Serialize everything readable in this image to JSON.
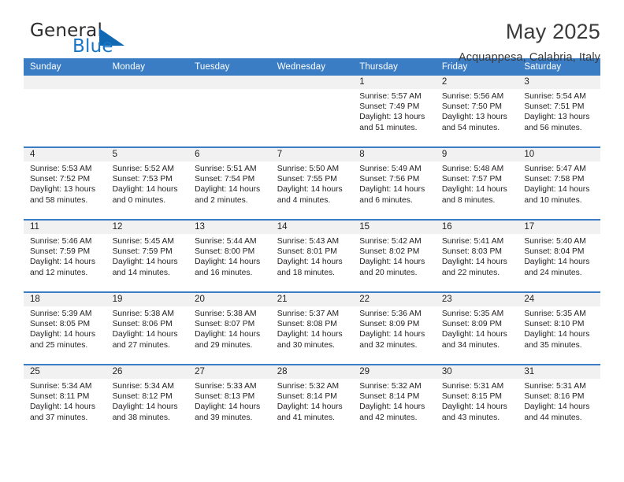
{
  "brand": {
    "name_part1": "General",
    "name_part2": "Blue",
    "accent_color": "#1168b3"
  },
  "header": {
    "month_title": "May 2025",
    "location": "Acquappesa, Calabria, Italy"
  },
  "calendar": {
    "header_background": "#3b7dc4",
    "daynum_band_background": "#f1f1f1",
    "weekday_headers": [
      "Sunday",
      "Monday",
      "Tuesday",
      "Wednesday",
      "Thursday",
      "Friday",
      "Saturday"
    ],
    "weeks": [
      [
        {
          "day": "",
          "sunrise": "",
          "sunset": "",
          "daylight_line1": "",
          "daylight_line2": ""
        },
        {
          "day": "",
          "sunrise": "",
          "sunset": "",
          "daylight_line1": "",
          "daylight_line2": ""
        },
        {
          "day": "",
          "sunrise": "",
          "sunset": "",
          "daylight_line1": "",
          "daylight_line2": ""
        },
        {
          "day": "",
          "sunrise": "",
          "sunset": "",
          "daylight_line1": "",
          "daylight_line2": ""
        },
        {
          "day": "1",
          "sunrise": "Sunrise: 5:57 AM",
          "sunset": "Sunset: 7:49 PM",
          "daylight_line1": "Daylight: 13 hours",
          "daylight_line2": "and 51 minutes."
        },
        {
          "day": "2",
          "sunrise": "Sunrise: 5:56 AM",
          "sunset": "Sunset: 7:50 PM",
          "daylight_line1": "Daylight: 13 hours",
          "daylight_line2": "and 54 minutes."
        },
        {
          "day": "3",
          "sunrise": "Sunrise: 5:54 AM",
          "sunset": "Sunset: 7:51 PM",
          "daylight_line1": "Daylight: 13 hours",
          "daylight_line2": "and 56 minutes."
        }
      ],
      [
        {
          "day": "4",
          "sunrise": "Sunrise: 5:53 AM",
          "sunset": "Sunset: 7:52 PM",
          "daylight_line1": "Daylight: 13 hours",
          "daylight_line2": "and 58 minutes."
        },
        {
          "day": "5",
          "sunrise": "Sunrise: 5:52 AM",
          "sunset": "Sunset: 7:53 PM",
          "daylight_line1": "Daylight: 14 hours",
          "daylight_line2": "and 0 minutes."
        },
        {
          "day": "6",
          "sunrise": "Sunrise: 5:51 AM",
          "sunset": "Sunset: 7:54 PM",
          "daylight_line1": "Daylight: 14 hours",
          "daylight_line2": "and 2 minutes."
        },
        {
          "day": "7",
          "sunrise": "Sunrise: 5:50 AM",
          "sunset": "Sunset: 7:55 PM",
          "daylight_line1": "Daylight: 14 hours",
          "daylight_line2": "and 4 minutes."
        },
        {
          "day": "8",
          "sunrise": "Sunrise: 5:49 AM",
          "sunset": "Sunset: 7:56 PM",
          "daylight_line1": "Daylight: 14 hours",
          "daylight_line2": "and 6 minutes."
        },
        {
          "day": "9",
          "sunrise": "Sunrise: 5:48 AM",
          "sunset": "Sunset: 7:57 PM",
          "daylight_line1": "Daylight: 14 hours",
          "daylight_line2": "and 8 minutes."
        },
        {
          "day": "10",
          "sunrise": "Sunrise: 5:47 AM",
          "sunset": "Sunset: 7:58 PM",
          "daylight_line1": "Daylight: 14 hours",
          "daylight_line2": "and 10 minutes."
        }
      ],
      [
        {
          "day": "11",
          "sunrise": "Sunrise: 5:46 AM",
          "sunset": "Sunset: 7:59 PM",
          "daylight_line1": "Daylight: 14 hours",
          "daylight_line2": "and 12 minutes."
        },
        {
          "day": "12",
          "sunrise": "Sunrise: 5:45 AM",
          "sunset": "Sunset: 7:59 PM",
          "daylight_line1": "Daylight: 14 hours",
          "daylight_line2": "and 14 minutes."
        },
        {
          "day": "13",
          "sunrise": "Sunrise: 5:44 AM",
          "sunset": "Sunset: 8:00 PM",
          "daylight_line1": "Daylight: 14 hours",
          "daylight_line2": "and 16 minutes."
        },
        {
          "day": "14",
          "sunrise": "Sunrise: 5:43 AM",
          "sunset": "Sunset: 8:01 PM",
          "daylight_line1": "Daylight: 14 hours",
          "daylight_line2": "and 18 minutes."
        },
        {
          "day": "15",
          "sunrise": "Sunrise: 5:42 AM",
          "sunset": "Sunset: 8:02 PM",
          "daylight_line1": "Daylight: 14 hours",
          "daylight_line2": "and 20 minutes."
        },
        {
          "day": "16",
          "sunrise": "Sunrise: 5:41 AM",
          "sunset": "Sunset: 8:03 PM",
          "daylight_line1": "Daylight: 14 hours",
          "daylight_line2": "and 22 minutes."
        },
        {
          "day": "17",
          "sunrise": "Sunrise: 5:40 AM",
          "sunset": "Sunset: 8:04 PM",
          "daylight_line1": "Daylight: 14 hours",
          "daylight_line2": "and 24 minutes."
        }
      ],
      [
        {
          "day": "18",
          "sunrise": "Sunrise: 5:39 AM",
          "sunset": "Sunset: 8:05 PM",
          "daylight_line1": "Daylight: 14 hours",
          "daylight_line2": "and 25 minutes."
        },
        {
          "day": "19",
          "sunrise": "Sunrise: 5:38 AM",
          "sunset": "Sunset: 8:06 PM",
          "daylight_line1": "Daylight: 14 hours",
          "daylight_line2": "and 27 minutes."
        },
        {
          "day": "20",
          "sunrise": "Sunrise: 5:38 AM",
          "sunset": "Sunset: 8:07 PM",
          "daylight_line1": "Daylight: 14 hours",
          "daylight_line2": "and 29 minutes."
        },
        {
          "day": "21",
          "sunrise": "Sunrise: 5:37 AM",
          "sunset": "Sunset: 8:08 PM",
          "daylight_line1": "Daylight: 14 hours",
          "daylight_line2": "and 30 minutes."
        },
        {
          "day": "22",
          "sunrise": "Sunrise: 5:36 AM",
          "sunset": "Sunset: 8:09 PM",
          "daylight_line1": "Daylight: 14 hours",
          "daylight_line2": "and 32 minutes."
        },
        {
          "day": "23",
          "sunrise": "Sunrise: 5:35 AM",
          "sunset": "Sunset: 8:09 PM",
          "daylight_line1": "Daylight: 14 hours",
          "daylight_line2": "and 34 minutes."
        },
        {
          "day": "24",
          "sunrise": "Sunrise: 5:35 AM",
          "sunset": "Sunset: 8:10 PM",
          "daylight_line1": "Daylight: 14 hours",
          "daylight_line2": "and 35 minutes."
        }
      ],
      [
        {
          "day": "25",
          "sunrise": "Sunrise: 5:34 AM",
          "sunset": "Sunset: 8:11 PM",
          "daylight_line1": "Daylight: 14 hours",
          "daylight_line2": "and 37 minutes."
        },
        {
          "day": "26",
          "sunrise": "Sunrise: 5:34 AM",
          "sunset": "Sunset: 8:12 PM",
          "daylight_line1": "Daylight: 14 hours",
          "daylight_line2": "and 38 minutes."
        },
        {
          "day": "27",
          "sunrise": "Sunrise: 5:33 AM",
          "sunset": "Sunset: 8:13 PM",
          "daylight_line1": "Daylight: 14 hours",
          "daylight_line2": "and 39 minutes."
        },
        {
          "day": "28",
          "sunrise": "Sunrise: 5:32 AM",
          "sunset": "Sunset: 8:14 PM",
          "daylight_line1": "Daylight: 14 hours",
          "daylight_line2": "and 41 minutes."
        },
        {
          "day": "29",
          "sunrise": "Sunrise: 5:32 AM",
          "sunset": "Sunset: 8:14 PM",
          "daylight_line1": "Daylight: 14 hours",
          "daylight_line2": "and 42 minutes."
        },
        {
          "day": "30",
          "sunrise": "Sunrise: 5:31 AM",
          "sunset": "Sunset: 8:15 PM",
          "daylight_line1": "Daylight: 14 hours",
          "daylight_line2": "and 43 minutes."
        },
        {
          "day": "31",
          "sunrise": "Sunrise: 5:31 AM",
          "sunset": "Sunset: 8:16 PM",
          "daylight_line1": "Daylight: 14 hours",
          "daylight_line2": "and 44 minutes."
        }
      ]
    ]
  }
}
